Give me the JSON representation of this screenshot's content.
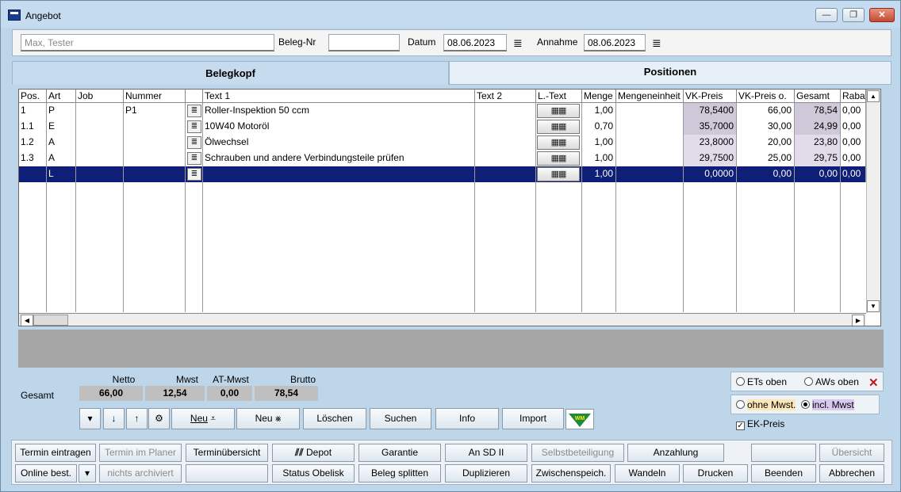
{
  "window": {
    "title": "Angebot"
  },
  "header": {
    "customer": "Max, Tester",
    "beleg_label": "Beleg-Nr",
    "beleg_value": "",
    "datum_label": "Datum",
    "datum_value": "08.06.2023",
    "annahme_label": "Annahme",
    "annahme_value": "08.06.2023"
  },
  "tabs": [
    {
      "label": "Belegkopf"
    },
    {
      "label": "Positionen"
    }
  ],
  "grid": {
    "columns": [
      "Pos.",
      "Art",
      "Job",
      "Nummer",
      "",
      "Text 1",
      "Text 2",
      "L.-Text",
      "Menge",
      "Mengeneinheit",
      "VK-Preis",
      "VK-Preis o.",
      "Gesamt",
      "Rabatt"
    ],
    "rows": [
      {
        "pos": "1",
        "art": "P",
        "job": "",
        "nummer": "P1",
        "text1": "Roller-Inspektion 50 ccm",
        "text2": "",
        "menge": "1,00",
        "einheit": "",
        "vk": "78,5400",
        "vko": "66,00",
        "gesamt": "78,54",
        "rabatt": "0,00"
      },
      {
        "pos": "1.1",
        "art": "E",
        "job": "",
        "nummer": "",
        "text1": "10W40 Motoröl",
        "text2": "",
        "menge": "0,70",
        "einheit": "",
        "vk": "35,7000",
        "vko": "30,00",
        "gesamt": "24,99",
        "rabatt": "0,00"
      },
      {
        "pos": "1.2",
        "art": "A",
        "job": "",
        "nummer": "",
        "text1": "Ölwechsel",
        "text2": "",
        "menge": "1,00",
        "einheit": "",
        "vk": "23,8000",
        "vko": "20,00",
        "gesamt": "23,80",
        "rabatt": "0,00"
      },
      {
        "pos": "1.3",
        "art": "A",
        "job": "",
        "nummer": "",
        "text1": "Schrauben und andere Verbindungsteile prüfen",
        "text2": "",
        "menge": "1,00",
        "einheit": "",
        "vk": "29,7500",
        "vko": "25,00",
        "gesamt": "29,75",
        "rabatt": "0,00"
      },
      {
        "pos": "",
        "art": "L",
        "job": "",
        "nummer": "",
        "text1": "",
        "text2": "",
        "menge": "1,00",
        "einheit": "",
        "vk": "0,0000",
        "vko": "0,00",
        "gesamt": "0,00",
        "rabatt": "0,00"
      }
    ]
  },
  "totals": {
    "label": "Gesamt",
    "netto_label": "Netto",
    "netto": "66,00",
    "mwst_label": "Mwst",
    "mwst": "12,54",
    "atmwst_label": "AT-Mwst",
    "atmwst": "0,00",
    "brutto_label": "Brutto",
    "brutto": "78,54"
  },
  "actions": {
    "neu1": "Neu",
    "neu2": "Neu",
    "loeschen": "Löschen",
    "suchen": "Suchen",
    "info": "Info",
    "import": "Import",
    "wm_logo": "WM"
  },
  "options": {
    "ets_oben": "ETs oben",
    "aws_oben": "AWs oben",
    "ohne_mwst": "ohne Mwst.",
    "incl_mwst": "incl. Mwst",
    "ek_preis": "EK-Preis"
  },
  "bottom": {
    "row1": [
      "Termin eintragen",
      "Termin im Planer",
      "Terminübersicht",
      "Depot",
      "Garantie",
      "An SD II",
      "Selbstbeteiligung",
      "Anzahlung",
      "",
      "Übersicht"
    ],
    "row2": [
      "Online best.",
      "nichts archiviert",
      "",
      "Status Obelisk",
      "Beleg splitten",
      "Duplizieren",
      "Zwischenspeich.",
      "Wandeln",
      "Drucken",
      "Beenden",
      "Abbrechen"
    ]
  },
  "colors": {
    "selection": "#0f1f78",
    "panel": "#bed6ea",
    "shade": "#cfc8d8"
  }
}
